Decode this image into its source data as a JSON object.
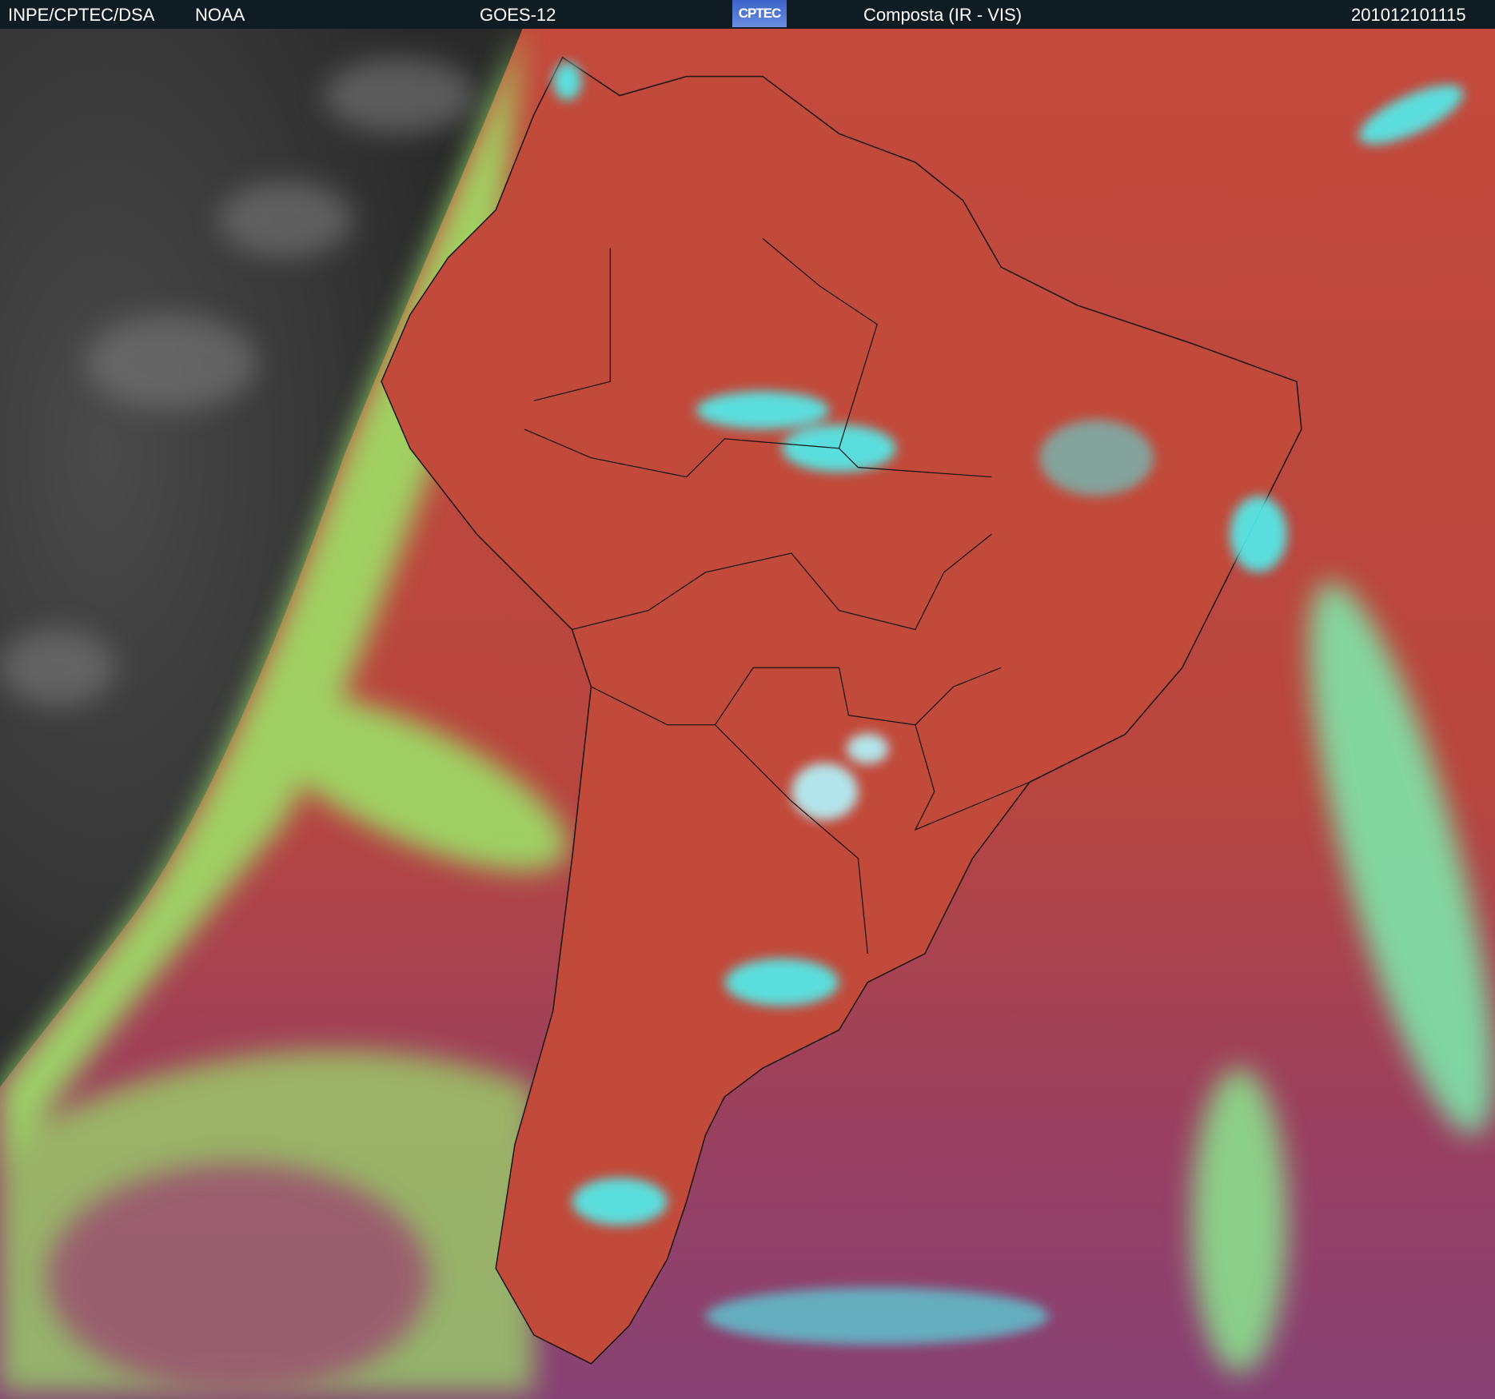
{
  "header": {
    "agency": "INPE/CPTEC/DSA",
    "source": "NOAA",
    "satellite": "GOES-12",
    "logo_text": "CPTEC",
    "product": "Composta (IR - VIS)",
    "timestamp": "201012101115"
  },
  "colors": {
    "header_bg": "#101c24",
    "land_red": "#c0463e",
    "ocean_purple": "#8e3f6c",
    "cloud_cyan": "#4ff0f0",
    "cloud_green": "#9be86a",
    "night_gray": "#3a3a3a"
  }
}
